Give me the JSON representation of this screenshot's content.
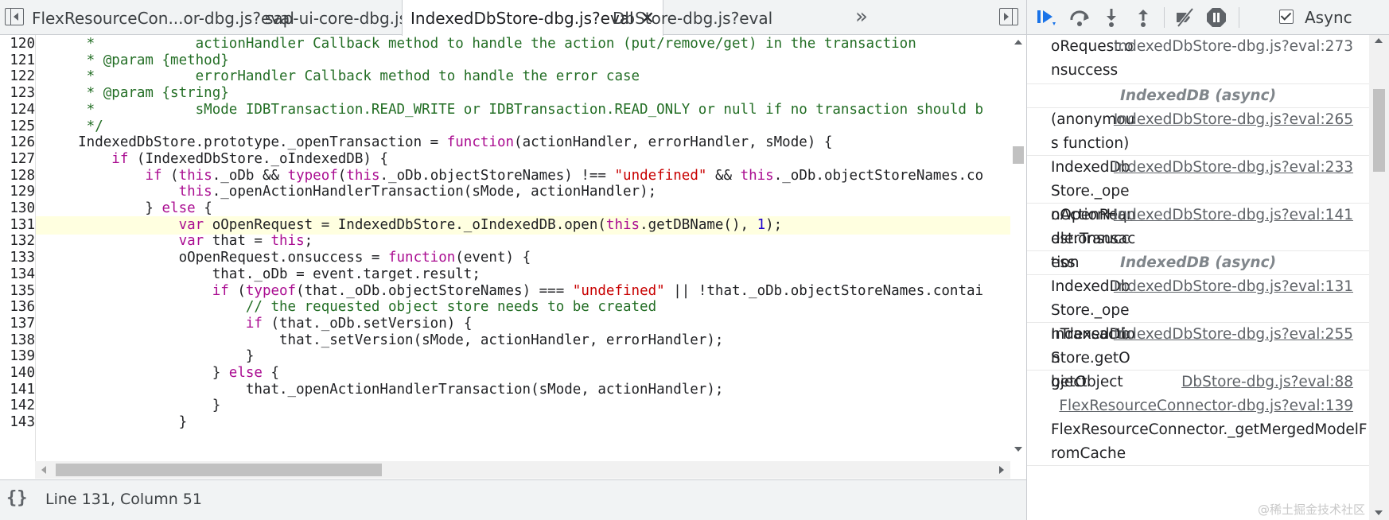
{
  "tabs": [
    {
      "label": "FlexResourceCon...or-dbg.js?eval",
      "active": false
    },
    {
      "label": "sap-ui-core-dbg.js",
      "active": false
    },
    {
      "label": "IndexedDbStore-dbg.js?eval",
      "active": true,
      "close": "✕"
    },
    {
      "label": "DbStore-dbg.js?eval",
      "active": false
    }
  ],
  "tab_overflow": "»",
  "code": {
    "highlighted_line": 131,
    "lines": [
      {
        "n": "120",
        "html": "<span class=\"cm\">     *            actionHandler Callback method to handle the action (put/remove/get) in the transaction</span>"
      },
      {
        "n": "121",
        "html": "<span class=\"cm\">     * @param {method}</span>"
      },
      {
        "n": "122",
        "html": "<span class=\"cm\">     *            errorHandler Callback method to handle the error case</span>"
      },
      {
        "n": "123",
        "html": "<span class=\"cm\">     * @param {string}</span>"
      },
      {
        "n": "124",
        "html": "<span class=\"cm\">     *            sMode IDBTransaction.READ_WRITE or IDBTransaction.READ_ONLY or null if no transaction should b</span>"
      },
      {
        "n": "125",
        "html": "<span class=\"cm\">     */</span>"
      },
      {
        "n": "126",
        "html": "    IndexedDbStore.prototype._openTransaction = <span class=\"kw\">function</span>(actionHandler, errorHandler, sMode) {"
      },
      {
        "n": "127",
        "html": "        <span class=\"kw\">if</span> (IndexedDbStore._oIndexedDB) {"
      },
      {
        "n": "128",
        "html": "            <span class=\"kw\">if</span> (<span class=\"kw\">this</span>._oDb &amp;&amp; <span class=\"kw\">typeof</span>(<span class=\"kw\">this</span>._oDb.objectStoreNames) !== <span class=\"st\">\"undefined\"</span> &amp;&amp; <span class=\"kw\">this</span>._oDb.objectStoreNames.co"
      },
      {
        "n": "129",
        "html": "                <span class=\"kw\">this</span>._openActionHandlerTransaction(sMode, actionHandler);"
      },
      {
        "n": "130",
        "html": "            } <span class=\"kw\">else</span> {"
      },
      {
        "n": "131",
        "html": "                <span class=\"kw\">var</span> oOpenRequest = IndexedDbStore._oIndexedDB.open(<span class=\"kw\">this</span>.getDBName(), <span class=\"nu\">1</span>);"
      },
      {
        "n": "132",
        "html": "                <span class=\"kw\">var</span> that = <span class=\"kw\">this</span>;"
      },
      {
        "n": "133",
        "html": "                oOpenRequest.onsuccess = <span class=\"kw\">function</span>(event) {"
      },
      {
        "n": "134",
        "html": "                    that._oDb = event.target.result;"
      },
      {
        "n": "135",
        "html": "                    <span class=\"kw\">if</span> (<span class=\"kw\">typeof</span>(that._oDb.objectStoreNames) === <span class=\"st\">\"undefined\"</span> || !that._oDb.objectStoreNames.contai"
      },
      {
        "n": "136",
        "html": "                        <span class=\"cm\">// the requested object store needs to be created</span>"
      },
      {
        "n": "137",
        "html": "                        <span class=\"kw\">if</span> (that._oDb.setVersion) {"
      },
      {
        "n": "138",
        "html": "                            that._setVersion(sMode, actionHandler, errorHandler);"
      },
      {
        "n": "139",
        "html": "                        }"
      },
      {
        "n": "140",
        "html": "                    } <span class=\"kw\">else</span> {"
      },
      {
        "n": "141",
        "html": "                        that._openActionHandlerTransaction(sMode, actionHandler);"
      },
      {
        "n": "142",
        "html": "                    }"
      },
      {
        "n": "143",
        "html": "                }"
      }
    ]
  },
  "status": {
    "braces": "{}",
    "position": "Line 131, Column 51"
  },
  "toolbar": {
    "async_label": "Async",
    "async_checked": true
  },
  "call_stack": [
    {
      "kind": "frame",
      "name": "oRequest.onsuccess",
      "location": "IndexedDbStore-dbg.js?eval:273",
      "underline": false
    },
    {
      "kind": "sep",
      "label": "IndexedDB (async)"
    },
    {
      "kind": "frame",
      "name": "(anonymous function)",
      "location": "IndexedDbStore-dbg.js?eval:265",
      "underline": true
    },
    {
      "kind": "frame",
      "name": "IndexedDbStore._openActionHandlerTransaction",
      "location": "IndexedDbStore-dbg.js?eval:233",
      "underline": true
    },
    {
      "kind": "frame",
      "name": "oOpenRequest.onsuccess",
      "location": "IndexedDbStore-dbg.js?eval:141",
      "underline": true
    },
    {
      "kind": "sep",
      "label": "IndexedDB (async)"
    },
    {
      "kind": "frame",
      "name": "IndexedDbStore._openTransaction",
      "location": "IndexedDbStore-dbg.js?eval:131",
      "underline": true
    },
    {
      "kind": "frame",
      "name": "IndexedDbStore.getObject",
      "location": "IndexedDbStore-dbg.js?eval:255",
      "underline": true
    },
    {
      "kind": "frame1",
      "name": "getObject",
      "location": "DbStore-dbg.js?eval:88",
      "underline": true
    },
    {
      "kind": "framewide",
      "name": "FlexResourceConnector._getMergedModelFromCache",
      "location": "FlexResourceConnector-dbg.js?eval:139",
      "underline": true
    }
  ],
  "watermark": "@稀土掘金技术社区"
}
